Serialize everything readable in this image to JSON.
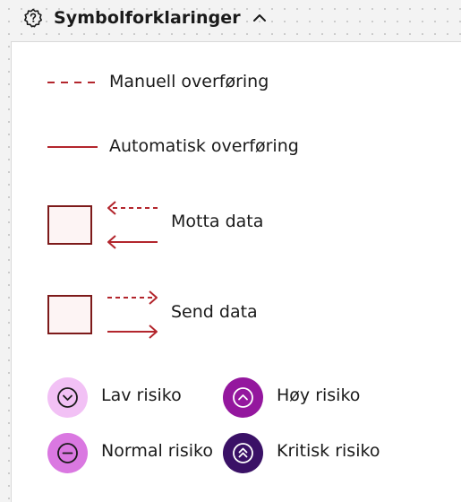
{
  "header": {
    "title": "Symbolforklaringer",
    "help_icon": "question-gear-icon",
    "toggle_icon": "chevron-up-icon"
  },
  "legend": {
    "lines": [
      {
        "label": "Manuell overføring",
        "style": "dashed"
      },
      {
        "label": "Automatisk overføring",
        "style": "solid"
      }
    ],
    "boxes": [
      {
        "label": "Motta data",
        "direction": "incoming"
      },
      {
        "label": "Send data",
        "direction": "outgoing"
      }
    ],
    "risks": [
      {
        "label": "Lav risiko",
        "color": "#f2c1f5",
        "icon": "chevron-down-circle-icon"
      },
      {
        "label": "Høy risiko",
        "color": "#94179e",
        "icon": "chevron-up-circle-icon"
      },
      {
        "label": "Normal risiko",
        "color": "#da78e1",
        "icon": "minus-circle-icon"
      },
      {
        "label": "Kritisk risiko",
        "color": "#3a1166",
        "icon": "double-chevron-up-circle-icon"
      }
    ]
  },
  "colors": {
    "line": "#b3262d",
    "box_border": "#7d1a1a",
    "box_fill": "#fdf4f4"
  }
}
